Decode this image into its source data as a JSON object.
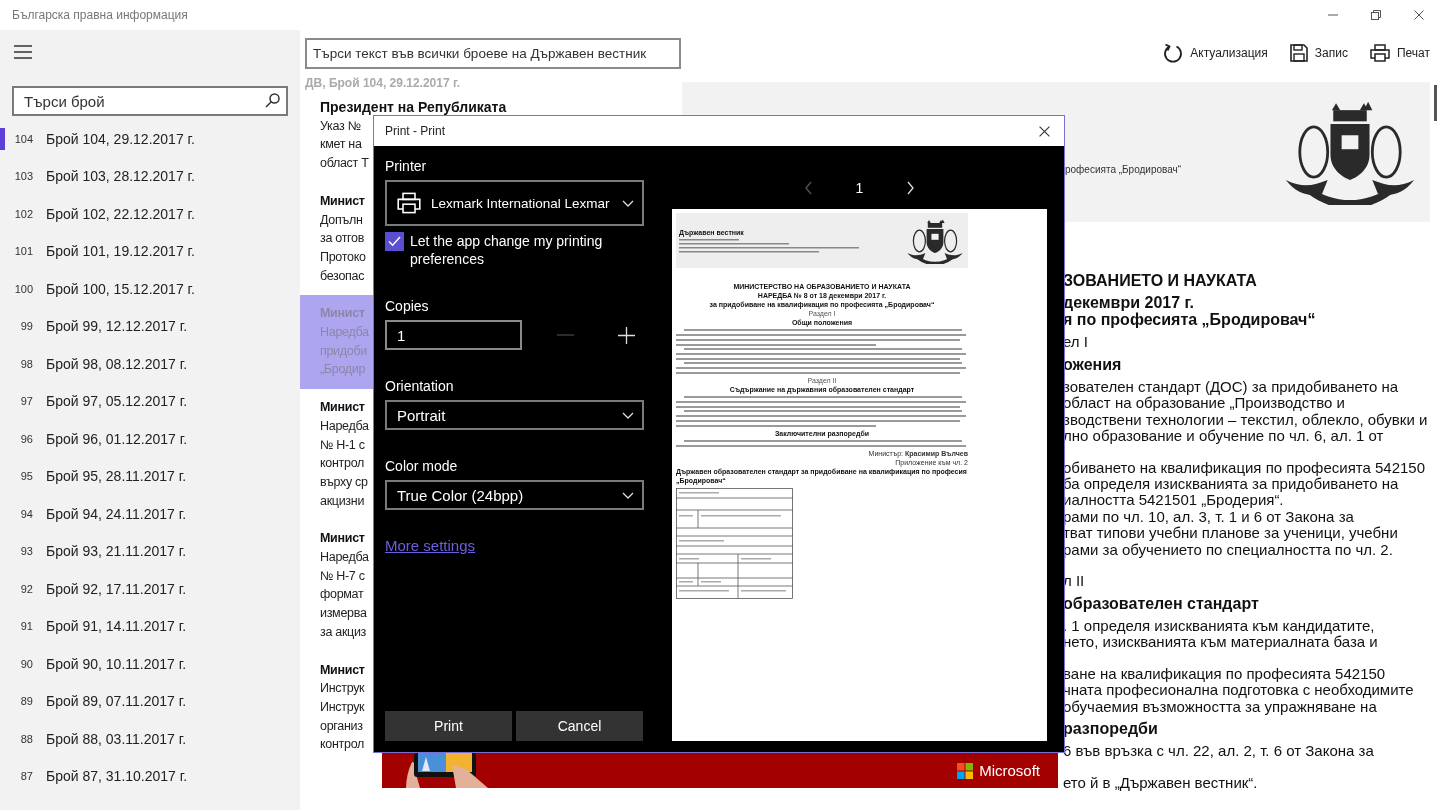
{
  "window": {
    "title": "Българска правна информация"
  },
  "sidebar": {
    "search": {
      "placeholder": "Търси брой"
    },
    "items": [
      {
        "number": "104",
        "label": "Брой 104, 29.12.2017 г.",
        "selected": true
      },
      {
        "number": "103",
        "label": "Брой 103, 28.12.2017 г.",
        "selected": false
      },
      {
        "number": "102",
        "label": "Брой 102, 22.12.2017 г.",
        "selected": false
      },
      {
        "number": "101",
        "label": "Брой 101, 19.12.2017 г.",
        "selected": false
      },
      {
        "number": "100",
        "label": "Брой 100, 15.12.2017 г.",
        "selected": false
      },
      {
        "number": "99",
        "label": "Брой 99, 12.12.2017 г.",
        "selected": false
      },
      {
        "number": "98",
        "label": "Брой 98, 08.12.2017 г.",
        "selected": false
      },
      {
        "number": "97",
        "label": "Брой 97, 05.12.2017 г.",
        "selected": false
      },
      {
        "number": "96",
        "label": "Брой 96, 01.12.2017 г.",
        "selected": false
      },
      {
        "number": "95",
        "label": "Брой 95, 28.11.2017 г.",
        "selected": false
      },
      {
        "number": "94",
        "label": "Брой 94, 24.11.2017 г.",
        "selected": false
      },
      {
        "number": "93",
        "label": "Брой 93, 21.11.2017 г.",
        "selected": false
      },
      {
        "number": "92",
        "label": "Брой 92, 17.11.2017 г.",
        "selected": false
      },
      {
        "number": "91",
        "label": "Брой 91, 14.11.2017 г.",
        "selected": false
      },
      {
        "number": "90",
        "label": "Брой 90, 10.11.2017 г.",
        "selected": false
      },
      {
        "number": "89",
        "label": "Брой 89, 07.11.2017 г.",
        "selected": false
      },
      {
        "number": "88",
        "label": "Брой 88, 03.11.2017 г.",
        "selected": false
      },
      {
        "number": "87",
        "label": "Брой 87, 31.10.2017 г.",
        "selected": false
      }
    ]
  },
  "search": {
    "placeholder": "Търси текст във всички броеве на Държавен вестник"
  },
  "toolbar": [
    {
      "kind": "refresh",
      "label": "Актуализация"
    },
    {
      "kind": "save",
      "label": "Запис"
    },
    {
      "kind": "print",
      "label": "Печат"
    }
  ],
  "issue_heading": "ДВ, Брой 104, 29.12.2017 г.",
  "entries": [
    {
      "title": "Президент на Републиката",
      "lines": [
        "Указ №",
        "кмет на",
        "област Т"
      ],
      "selected": false
    },
    {
      "title": "Минист",
      "lines": [
        "Допълн",
        "за отгов",
        "Протоко",
        "безопас"
      ],
      "selected": false
    },
    {
      "title": "Минист",
      "lines": [
        "Наредба",
        "придоби",
        "„Бродир"
      ],
      "selected": true
    },
    {
      "title": "Минист",
      "lines": [
        "Наредба",
        "№ Н-1 с",
        "контрол",
        "върху ср",
        "акцизни"
      ],
      "selected": false
    },
    {
      "title": "Минист",
      "lines": [
        "Наредба",
        "№ Н-7 с",
        "формат",
        "измерва",
        "за акциз"
      ],
      "selected": false
    },
    {
      "title": "Минист",
      "lines": [
        "Инструк",
        "Инструк",
        "организ",
        "контрол"
      ],
      "selected": false
    }
  ],
  "document": {
    "banner_text": "рофесията „Бродировач“",
    "paragraphs": [
      {
        "kind": "heading",
        "lines": [
          "ЗОВАНИЕТО И НАУКАТА"
        ]
      },
      {
        "kind": "heading",
        "lines": [
          "декември 2017 г.",
          "я по професията „Бродировач“"
        ]
      },
      {
        "kind": "text",
        "lines": [
          "ел I"
        ]
      },
      {
        "kind": "heading",
        "lines": [
          "ожения"
        ]
      },
      {
        "kind": "text",
        "lines": [
          "зователен стандарт (ДОС) за придобиването на",
          "област на образование „Производство и",
          "зводствени технологии – текстил, облекло, обувки и",
          "лно образование и обучение по чл. 6, ал. 1 от"
        ]
      },
      {
        "kind": "text",
        "lines": [
          "обиването на квалификация по професията 542150",
          "ба определя изискванията за придобиването на",
          "иалността 5421501 „Бродерия“.",
          "рами по чл. 10, ал. 3, т. 1 и 6 от Закона за",
          "тват типови учебни планове за ученици, учебни",
          "рами за обучението по специалността по чл. 2."
        ]
      },
      {
        "kind": "text",
        "lines": [
          "л II"
        ]
      },
      {
        "kind": "heading",
        "lines": [
          "образователен стандарт"
        ]
      },
      {
        "kind": "text",
        "lines": [
          ". 1 определя изискванията към кандидатите,",
          "нето, изискванията към материалната база и"
        ]
      },
      {
        "kind": "text",
        "lines": [
          "ване на квалификация по професията 542150",
          "чната професионална подготовка с необходимите",
          "обучаемия възможността за упражняване на"
        ]
      },
      {
        "kind": "heading",
        "lines": [
          "разпоредби"
        ]
      },
      {
        "kind": "text",
        "lines": [
          "6 във връзка с чл. 22, ал. 2, т. 6 от Закона за"
        ]
      },
      {
        "kind": "text",
        "lines": [
          "ето й в „Държавен вестник“."
        ]
      }
    ]
  },
  "ad": {
    "brand": "Microsoft"
  },
  "print_dialog": {
    "title": "Print - Print",
    "printer": {
      "label": "Printer",
      "value": "Lexmark International Lexmar"
    },
    "app_preferences": {
      "label": "Let the app change my printing preferences",
      "checked": true
    },
    "copies": {
      "label": "Copies",
      "value": "1",
      "decrease_disabled": true,
      "increase_disabled": false
    },
    "orientation": {
      "label": "Orientation",
      "value": "Portrait"
    },
    "color_mode": {
      "label": "Color mode",
      "value": "True Color (24bpp)"
    },
    "more_settings": "More settings",
    "buttons": [
      "Print",
      "Cancel"
    ],
    "preview": {
      "page": "1",
      "previous_disabled": true,
      "next_disabled": false,
      "content": [
        {
          "kind": "masthead",
          "text": "Държавен вестник"
        },
        {
          "kind": "heading",
          "text": "МИНИСТЕРСТВО  НА ОБРАЗОВАНИЕТО И НАУКАТА"
        },
        {
          "kind": "heading",
          "text": "НАРЕДБА № 8  от 18 декември 2017 г."
        },
        {
          "kind": "heading",
          "text": "за придобиване на квалификация по професията „Бродировач“"
        },
        {
          "kind": "subheading",
          "text": "Раздел I"
        },
        {
          "kind": "heading",
          "text": "Общи положения"
        },
        {
          "kind": "paragraph"
        },
        {
          "kind": "paragraph"
        },
        {
          "kind": "paragraph"
        },
        {
          "kind": "subheading",
          "text": "Раздел II"
        },
        {
          "kind": "heading",
          "text": "Съдържание на държавния образователен стандарт"
        },
        {
          "kind": "paragraph"
        },
        {
          "kind": "paragraph"
        },
        {
          "kind": "heading",
          "text": "Заключителни разпоредби"
        },
        {
          "kind": "paragraph"
        },
        {
          "kind": "signature",
          "text": "Министър: **Красимир Вълчев**"
        },
        {
          "kind": "note",
          "text": "Приложение към чл. 2"
        },
        {
          "kind": "caption",
          "text": "Държавен образователен стандарт за придобиване на квалификация по професия „Бродировач“"
        },
        {
          "kind": "table"
        }
      ]
    }
  }
}
